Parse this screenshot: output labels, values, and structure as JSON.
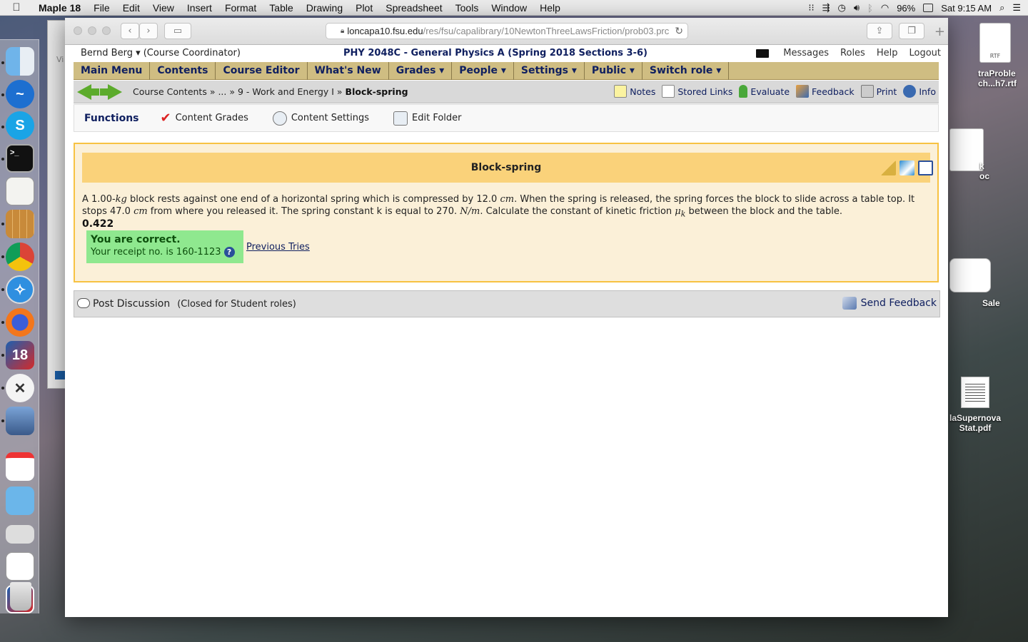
{
  "menubar": {
    "apple": "",
    "app_name": "Maple 18",
    "items": [
      "File",
      "Edit",
      "View",
      "Insert",
      "Format",
      "Table",
      "Drawing",
      "Plot",
      "Spreadsheet",
      "Tools",
      "Window",
      "Help"
    ],
    "battery": "96%",
    "clock": "Sat 9:15 AM"
  },
  "desktop": {
    "files": [
      {
        "label1": "RTF",
        "label2": "traProble",
        "label3": "ch...h7.rtf"
      },
      {
        "label1": "k",
        "label2": "oc"
      },
      {
        "label1": "Sale"
      },
      {
        "label1": "laSupernova",
        "label2": "Stat.pdf"
      }
    ],
    "bg_window_label": "Vi"
  },
  "browser": {
    "url_host": "loncapa10.fsu.edu",
    "url_path": "/res/fsu/capalibrary/10NewtonThreeLawsFriction/prob03.prc"
  },
  "page": {
    "user": "Bernd Berg ▾ (Course Coordinator)",
    "course_title": "PHY 2048C - General Physics A (Spring 2018 Sections 3-6)",
    "top_links": [
      "Messages",
      "Roles",
      "Help",
      "Logout"
    ],
    "main_menu": [
      "Main Menu",
      "Contents",
      "Course Editor",
      "What's New",
      "Grades ▾",
      "People ▾",
      "Settings ▾",
      "Public ▾",
      "Switch role ▾"
    ],
    "breadcrumb": {
      "part1": "Course Contents »",
      "part2": "... »",
      "part3": "9 - Work and Energy I »",
      "current": "Block-spring"
    },
    "tools": [
      "Notes",
      "Stored Links",
      "Evaluate",
      "Feedback",
      "Print",
      "Info"
    ],
    "functions": {
      "heading": "Functions",
      "items": [
        "Content Grades",
        "Content Settings",
        "Edit Folder"
      ]
    },
    "problem": {
      "title": "Block-spring",
      "text_a": "A 1.00-",
      "unit_kg": "kg",
      "text_b": " block rests against one end of a horizontal spring which is compressed by 12.0 ",
      "unit_cm": "cm",
      "text_c": ". When the spring is released, the spring forces the block to slide across a table top. It stops 47.0 ",
      "unit_cm2": "cm",
      "text_d": " from where you released it. The spring constant k is equal to 270. ",
      "unit_nm": "N/m",
      "text_e": ". Calculate the constant of kinetic friction ",
      "mu": "μ",
      "mu_sub": "k",
      "text_f": " between the block and the table.",
      "answer": "0.422",
      "correct_label": "You are correct.",
      "receipt": "Your receipt no. is 160-1123",
      "help_glyph": "?",
      "previous_tries": "Previous Tries"
    },
    "discussion": {
      "post": "Post Discussion",
      "closed": "(Closed for Student roles)",
      "send_feedback": "Send Feedback"
    }
  },
  "colors": {
    "menu_bg": "#cfbd82",
    "problem_border": "#f7c242",
    "problem_title_bg": "#fad27a",
    "correct_bg": "#8fe88f",
    "link": "#102060"
  }
}
